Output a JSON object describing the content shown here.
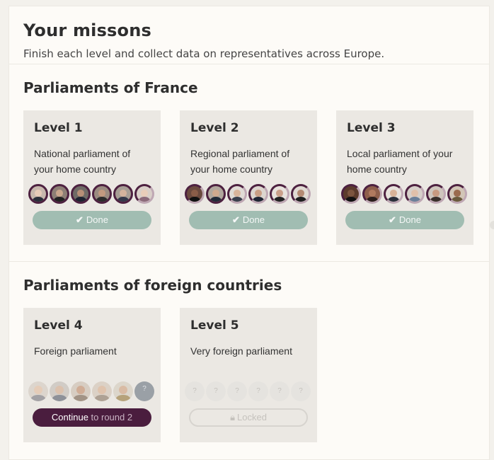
{
  "header": {
    "title": "Your missons",
    "subtitle": "Finish each level and collect data on representatives across Europe."
  },
  "sections": [
    {
      "title": "Parliaments of France",
      "levels": [
        {
          "title": "Level 1",
          "line1": "National parliament of",
          "line2": "your home country",
          "button": "Done"
        },
        {
          "title": "Level 2",
          "line1": "Regional parliament of",
          "line2": "your home country",
          "button": "Done"
        },
        {
          "title": "Level 3",
          "line1": "Local parliament of your",
          "line2": "home country",
          "button": "Done"
        }
      ]
    },
    {
      "title": "Parliaments of foreign countries",
      "levels": [
        {
          "title": "Level 4",
          "line1": "Foreign parliament",
          "button_main": "Continue",
          "button_rest": " to round 2"
        },
        {
          "title": "Level 5",
          "line1": "Very foreign parliament",
          "button": "Locked"
        }
      ]
    }
  ],
  "placeholder_glyph": "?",
  "colors": {
    "done_button": "#a1bdb2",
    "continue_button": "#4a1d3e",
    "avatar_ring": "#4d2140",
    "card_bg": "#ebe8e3"
  }
}
